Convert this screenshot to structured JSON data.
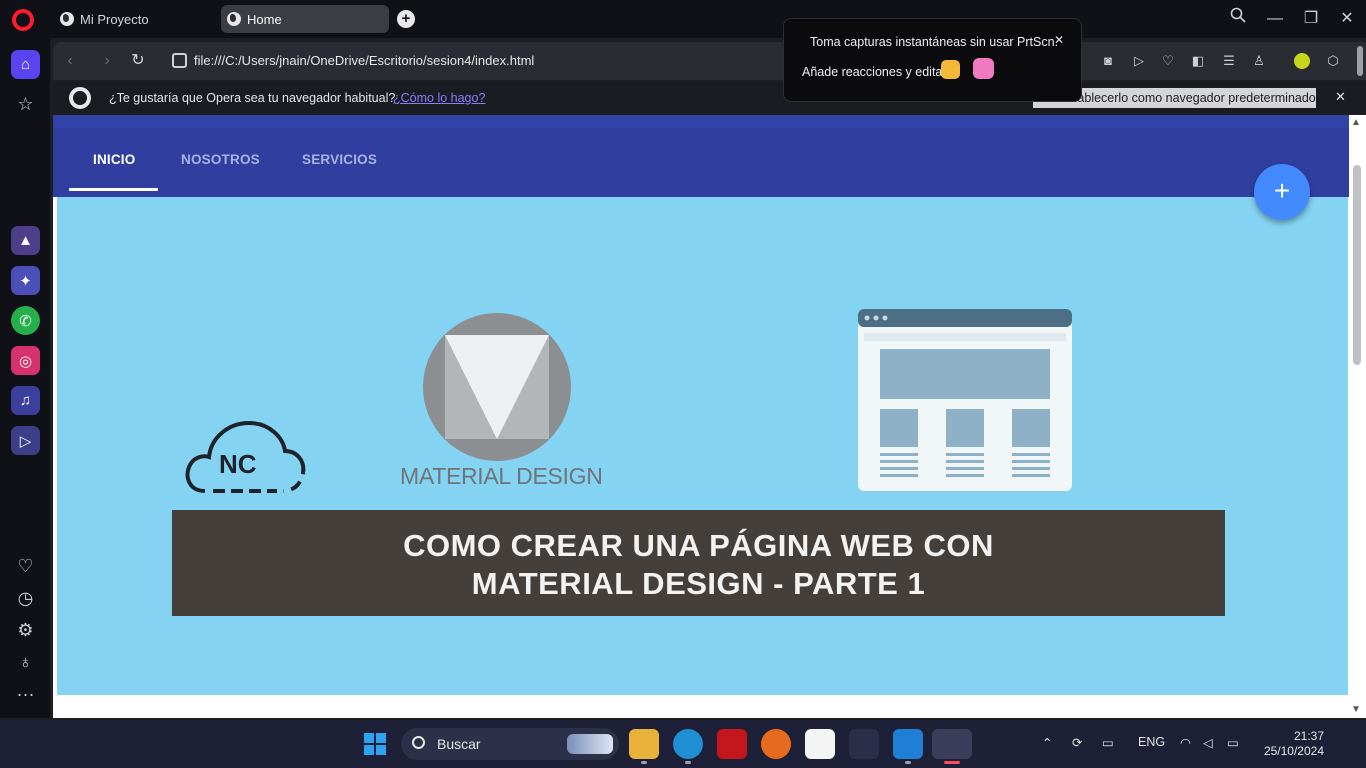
{
  "browser": {
    "tabs": [
      {
        "label": "Mi Proyecto"
      },
      {
        "label": "Home"
      }
    ],
    "address": "file:///C:/Users/jnain/OneDrive/Escritorio/sesion4/index.html"
  },
  "infobar": {
    "message": "¿Te gustaría que Opera sea tu navegador habitual?",
    "link": "¿Cómo lo hago?",
    "button": "...ablecerlo como navegador predeterminado"
  },
  "popup": {
    "line1": "Toma capturas instantáneas sin usar PrtScn.",
    "line2": "Añade reacciones y edita"
  },
  "page": {
    "tabs": [
      "INICIO",
      "NOSOTROS",
      "SERVICIOS"
    ],
    "active_tab": "INICIO",
    "fab_symbol": "+",
    "hero": {
      "logo_nc": "NC",
      "logo_md": "MATERIAL DESIGN",
      "title_line1": "COMO CREAR UNA PÁGINA WEB CON",
      "title_line2": "MATERIAL DESIGN - PARTE 1"
    },
    "colors": {
      "appbar": "#303f9f",
      "hero_bg": "#84d3f3",
      "fab": "#448aff",
      "banner": "#443f3b"
    }
  },
  "taskbar": {
    "search_label": "Buscar",
    "language": "ENG",
    "time": "21:37",
    "date": "25/10/2024"
  }
}
